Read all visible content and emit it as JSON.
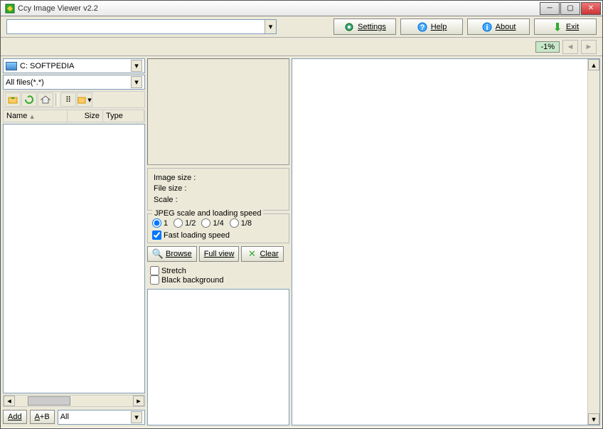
{
  "window": {
    "title": "Ccy Image Viewer v2.2"
  },
  "toolbar": {
    "settings": "Settings",
    "help": "Help",
    "about": "About",
    "exit": "Exit"
  },
  "zoom": {
    "value": "-1%"
  },
  "drive": {
    "label": "C: SOFTPEDIA"
  },
  "filter": {
    "label": "All files(*.*)"
  },
  "columns": {
    "name": "Name",
    "size": "Size",
    "type": "Type"
  },
  "bottom": {
    "add": "Add",
    "ab": "A+B",
    "all": "All"
  },
  "info": {
    "imgsize": "Image size :",
    "filesize": "File size :",
    "scale": "Scale :"
  },
  "jpeg": {
    "legend": "JPEG scale and loading speed",
    "r1": "1",
    "r12": "1/2",
    "r14": "1/4",
    "r18": "1/8",
    "fast": "Fast loading speed"
  },
  "actions": {
    "browse": "Browse",
    "fullview": "Full view",
    "clear": "Clear"
  },
  "opts": {
    "stretch": "Stretch",
    "blackbg": "Black background"
  }
}
